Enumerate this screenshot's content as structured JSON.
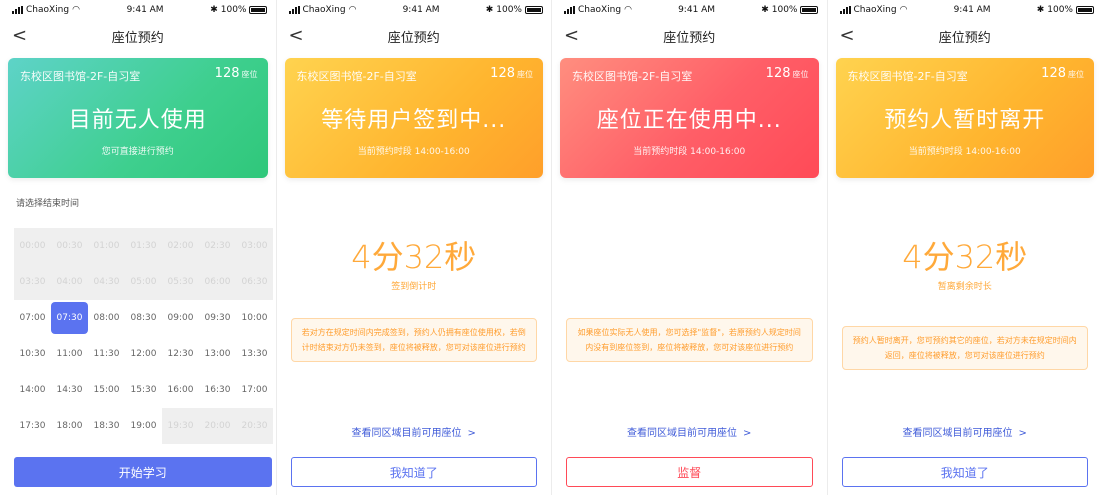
{
  "status": {
    "carrier": "ChaoXing",
    "time": "9:41 AM",
    "battery": "100%"
  },
  "nav": {
    "title": "座位预约"
  },
  "card": {
    "location": "东校区图书馆-2F-自习室",
    "seat_count": "128",
    "seat_unit": "座位"
  },
  "panel1": {
    "main": "目前无人使用",
    "sub": "您可直接进行预约",
    "prompt": "请选择结束时间",
    "rows": [
      [
        "00:00",
        "00:30",
        "01:00",
        "01:30",
        "02:00",
        "02:30",
        "03:00"
      ],
      [
        "03:30",
        "04:00",
        "04:30",
        "05:00",
        "05:30",
        "06:00",
        "06:30"
      ],
      [
        "07:00",
        "07:30",
        "08:00",
        "08:30",
        "09:00",
        "09:30",
        "10:00"
      ],
      [
        "10:30",
        "11:00",
        "11:30",
        "12:00",
        "12:30",
        "13:00",
        "13:30"
      ],
      [
        "14:00",
        "14:30",
        "15:00",
        "15:30",
        "16:00",
        "16:30",
        "17:00"
      ],
      [
        "17:30",
        "18:00",
        "18:30",
        "19:00",
        "19:30",
        "20:00",
        "20:30"
      ]
    ],
    "selected": "07:30",
    "button": "开始学习"
  },
  "panel2": {
    "main": "等待用户签到中...",
    "sub": "当前预约时段 14:00-16:00",
    "countdown": "4分32秒",
    "countdown_label": "签到倒计时",
    "notice": "若对方在规定时间内完成签到，预约人仍拥有座位使用权，若倒计时结束对方仍未签到，座位将被释放，您可对该座位进行预约",
    "link": "查看同区域目前可用座位",
    "button": "我知道了"
  },
  "panel3": {
    "main": "座位正在使用中...",
    "sub": "当前预约时段 14:00-16:00",
    "notice": "如果座位实际无人使用，您可选择\"监督\"，若原预约人规定时间内没有到座位签到，座位将被释放，您可对该座位进行预约",
    "link": "查看同区域目前可用座位",
    "button": "监督"
  },
  "panel4": {
    "main": "预约人暂时离开",
    "sub": "当前预约时段 14:00-16:00",
    "countdown": "4分32秒",
    "countdown_label": "暂离剩余时长",
    "notice": "预约人暂时离开，您可预约其它的座位，若对方未在规定时间内返回，座位将被释放，您可对该座位进行预约",
    "link": "查看同区域目前可用座位",
    "button": "我知道了"
  },
  "colors": {
    "accent": "#5b73f0",
    "orange": "#ffa93a",
    "red": "#ff4a57",
    "green": "#3ecf8e"
  }
}
